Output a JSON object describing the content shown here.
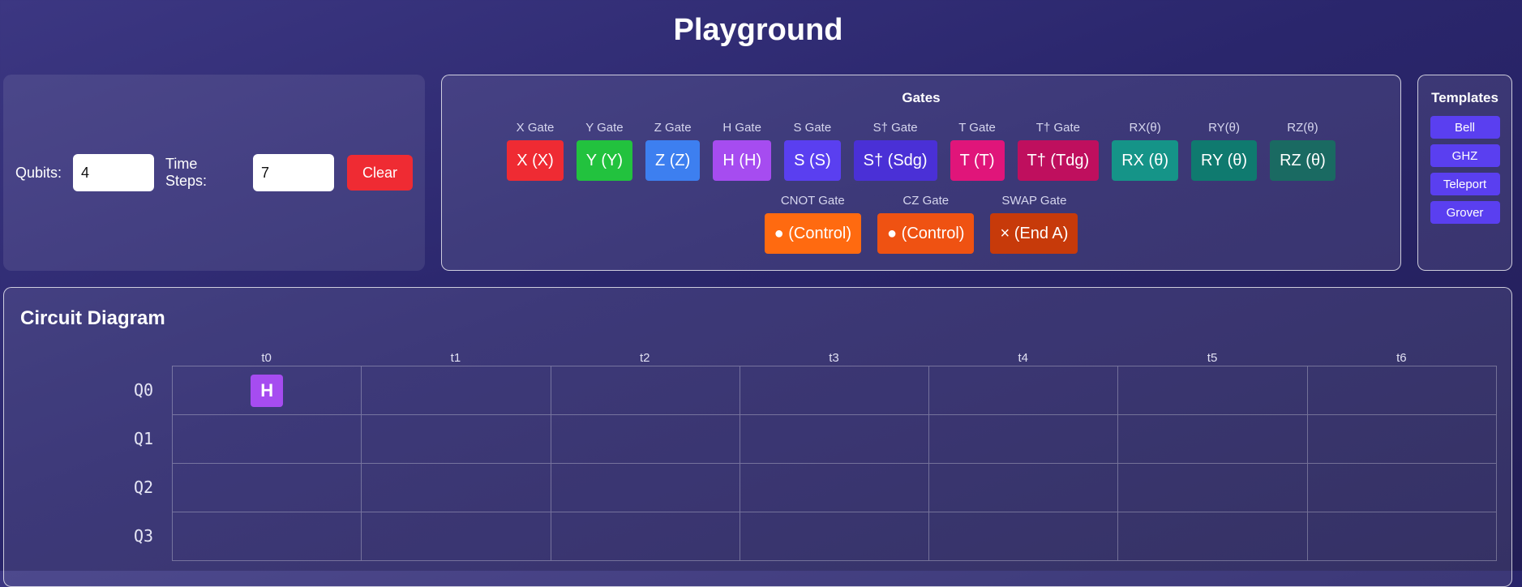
{
  "title": "Playground",
  "controls": {
    "qubits_label": "Qubits:",
    "qubits_value": "4",
    "time_steps_label": "Time Steps:",
    "time_steps_value": "7",
    "clear_label": "Clear"
  },
  "gates_panel": {
    "heading": "Gates",
    "single": [
      {
        "name": "X Gate",
        "label": "X (X)",
        "color": "#ef2b33"
      },
      {
        "name": "Y Gate",
        "label": "Y (Y)",
        "color": "#22c23e"
      },
      {
        "name": "Z Gate",
        "label": "Z (Z)",
        "color": "#3d7ff0"
      },
      {
        "name": "H Gate",
        "label": "H (H)",
        "color": "#a64cf0"
      },
      {
        "name": "S Gate",
        "label": "S (S)",
        "color": "#5a3ff0"
      },
      {
        "name": "S† Gate",
        "label": "S† (Sdg)",
        "color": "#4a30d6"
      },
      {
        "name": "T Gate",
        "label": "T (T)",
        "color": "#e0157a"
      },
      {
        "name": "T† Gate",
        "label": "T† (Tdg)",
        "color": "#bf0f5e"
      },
      {
        "name": "RX(θ)",
        "label": "RX (θ)",
        "color": "#159488"
      },
      {
        "name": "RY(θ)",
        "label": "RY (θ)",
        "color": "#0f7a6f"
      },
      {
        "name": "RZ(θ)",
        "label": "RZ (θ)",
        "color": "#1a6a62"
      }
    ],
    "multi": [
      {
        "name": "CNOT Gate",
        "label": "● (Control)",
        "color": "#ff6a10"
      },
      {
        "name": "CZ Gate",
        "label": "● (Control)",
        "color": "#ef5212"
      },
      {
        "name": "SWAP Gate",
        "label": "× (End A)",
        "color": "#c73a0a"
      }
    ]
  },
  "templates_panel": {
    "heading": "Templates",
    "items": [
      "Bell",
      "GHZ",
      "Teleport",
      "Grover"
    ]
  },
  "circuit": {
    "title": "Circuit Diagram",
    "time_steps": [
      "t0",
      "t1",
      "t2",
      "t3",
      "t4",
      "t5",
      "t6"
    ],
    "qubits": [
      "Q0",
      "Q1",
      "Q2",
      "Q3"
    ],
    "placed_gates": [
      {
        "qubit": 0,
        "step": 0,
        "label": "H",
        "color": "#a64cf0"
      }
    ]
  }
}
